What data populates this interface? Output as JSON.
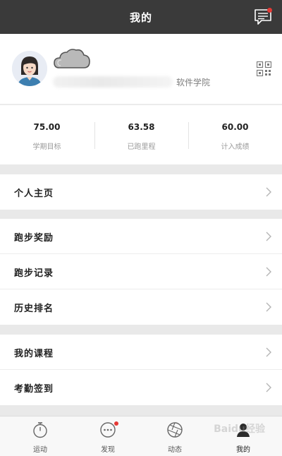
{
  "header": {
    "title": "我的"
  },
  "profile": {
    "school": "软件学院"
  },
  "stats": [
    {
      "value": "75.00",
      "label": "学期目标"
    },
    {
      "value": "63.58",
      "label": "已跑里程"
    },
    {
      "value": "60.00",
      "label": "计入成绩"
    }
  ],
  "menu": {
    "homepage": "个人主页",
    "running_reward": "跑步奖励",
    "running_record": "跑步记录",
    "history_ranking": "历史排名",
    "my_courses": "我的课程",
    "attendance": "考勤签到"
  },
  "tabs": [
    {
      "label": "运动",
      "icon": "stopwatch-icon"
    },
    {
      "label": "发现",
      "icon": "discover-icon"
    },
    {
      "label": "动态",
      "icon": "moments-icon"
    },
    {
      "label": "我的",
      "icon": "profile-icon"
    }
  ],
  "watermark": "Baidu经验",
  "colors": {
    "header_bg": "#3a3a3a",
    "badge": "#e53935",
    "page_bg": "#e9e9e9"
  }
}
